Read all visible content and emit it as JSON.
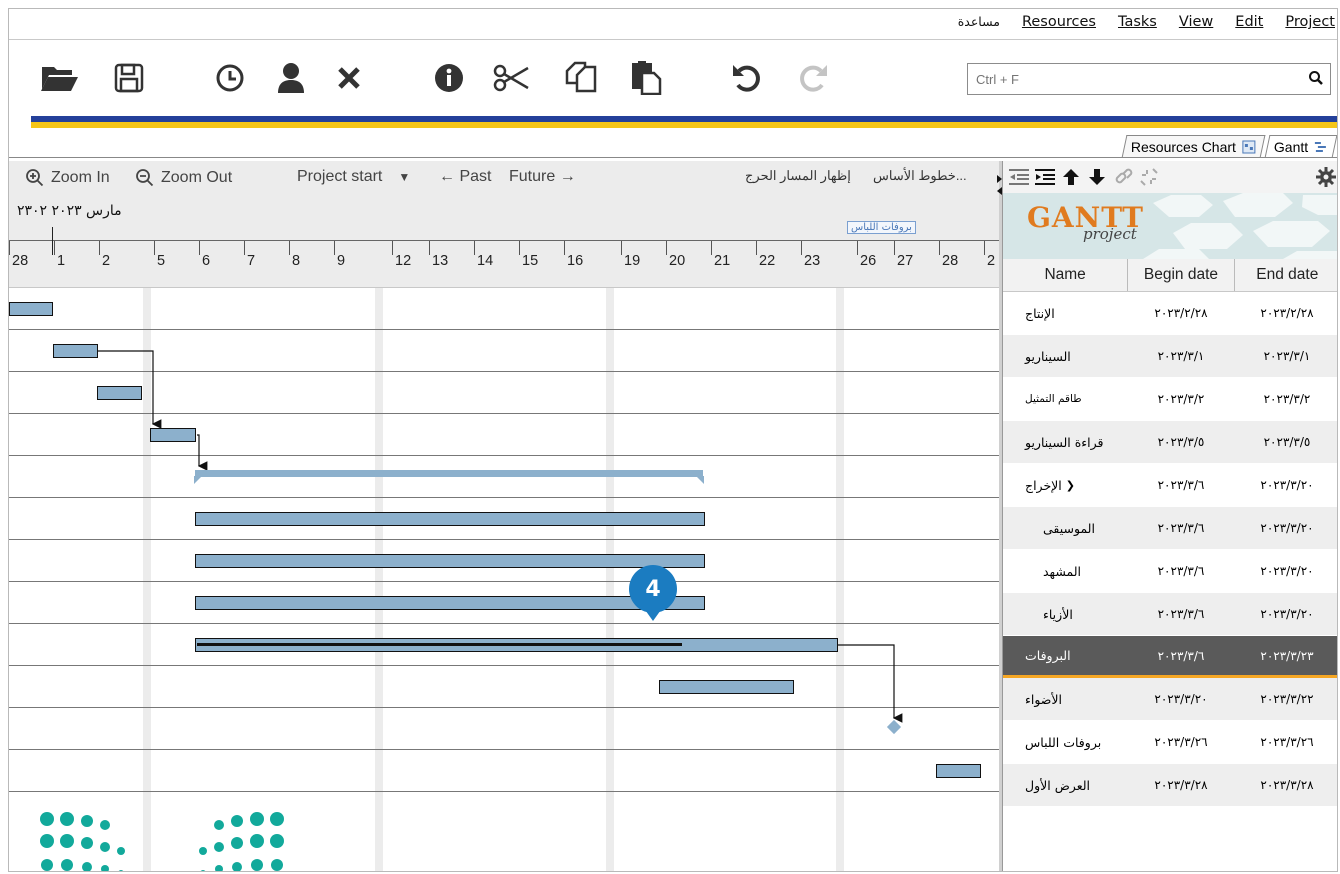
{
  "menu": {
    "items": [
      "مساعدة",
      "Resources",
      "Tasks",
      "View",
      "Edit",
      "Project"
    ]
  },
  "search": {
    "placeholder": "Ctrl + F"
  },
  "tabs": {
    "resources": "Resources Chart",
    "gantt": "Gantt"
  },
  "chart_controls": {
    "zoom_in": "Zoom In",
    "zoom_out": "Zoom Out",
    "project_start": "Project start",
    "past": "← Past",
    "future": "Future →",
    "baseline": "خطوط الأساس...",
    "critical_path": "إظهار المسار الحرج"
  },
  "timeline": {
    "month_label": "مارس ٢٠٢٣ ٢٣٠٢",
    "milestone_label": "بروفات اللباس",
    "days": [
      "28",
      "1",
      "2",
      "5",
      "6",
      "7",
      "8",
      "9",
      "12",
      "13",
      "14",
      "15",
      "16",
      "19",
      "20",
      "21",
      "22",
      "23",
      "26",
      "27",
      "28",
      "2"
    ]
  },
  "badge": {
    "number": "4"
  },
  "logo": {
    "main": "GANTT",
    "sub": "project"
  },
  "table": {
    "headers": {
      "name": "Name",
      "begin": "Begin date",
      "end": "End date"
    },
    "rows": [
      {
        "name": "الإنتاج",
        "begin": "٢٠٢٣/٢/٢٨",
        "end": "٢٠٢٣/٢/٢٨"
      },
      {
        "name": "السيناريو",
        "begin": "٢٠٢٣/٣/١",
        "end": "٢٠٢٣/٣/١"
      },
      {
        "name": "طاقم التمثيل",
        "begin": "٢٠٢٣/٣/٢",
        "end": "٢٠٢٣/٣/٢"
      },
      {
        "name": "قراءة السيناريو",
        "begin": "٢٠٢٣/٣/٥",
        "end": "٢٠٢٣/٣/٥"
      },
      {
        "name": "الإخراج",
        "begin": "٢٠٢٣/٣/٦",
        "end": "٢٠٢٣/٣/٢٠"
      },
      {
        "name": "الموسيقى",
        "begin": "٢٠٢٣/٣/٦",
        "end": "٢٠٢٣/٣/٢٠"
      },
      {
        "name": "المشهد",
        "begin": "٢٠٢٣/٣/٦",
        "end": "٢٠٢٣/٣/٢٠"
      },
      {
        "name": "الأزياء",
        "begin": "٢٠٢٣/٣/٦",
        "end": "٢٠٢٣/٣/٢٠"
      },
      {
        "name": "البروفات",
        "begin": "٢٠٢٣/٣/٦",
        "end": "٢٠٢٣/٣/٢٣"
      },
      {
        "name": "الأضواء",
        "begin": "٢٠٢٣/٣/٢٠",
        "end": "٢٠٢٣/٣/٢٢"
      },
      {
        "name": "بروفات اللباس",
        "begin": "٢٠٢٣/٣/٢٦",
        "end": "٢٠٢٣/٣/٢٦"
      },
      {
        "name": "العرض الأول",
        "begin": "٢٠٢٣/٣/٢٨",
        "end": "٢٠٢٣/٣/٢٨"
      }
    ]
  },
  "colors": {
    "bar": "#8cb0cc",
    "selected_row": "#5a5a5a",
    "selected_underline": "#f5a623",
    "stripe_blue": "#24409a",
    "stripe_yellow": "#f5c518",
    "badge": "#1b7cc1"
  }
}
